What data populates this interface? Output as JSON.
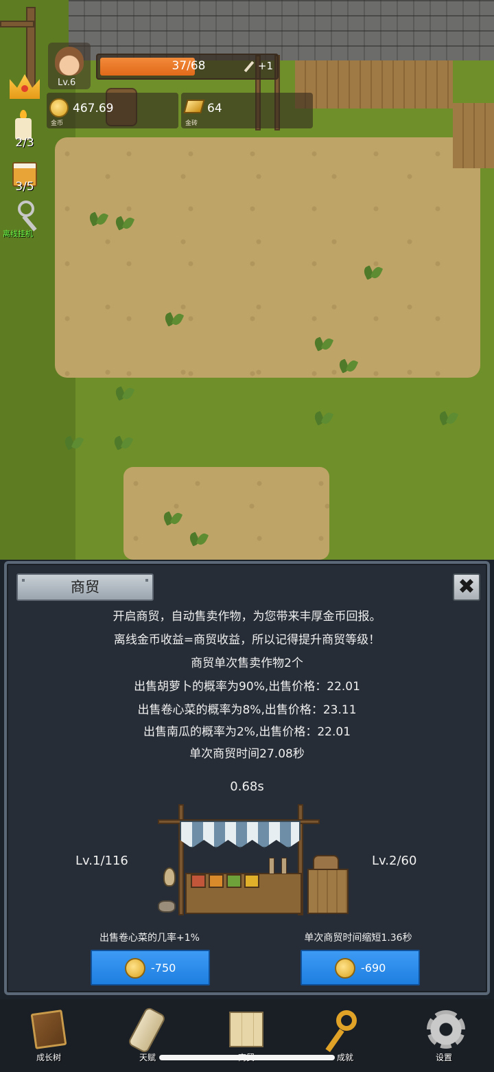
{
  "hud": {
    "level": "Lv.6",
    "xp_text": "37/68",
    "xp_progress": 0.544,
    "xp_bonus": "+1",
    "coins": "467.69",
    "coins_label": "金币",
    "gold_bars": "64",
    "gold_label": "金砖"
  },
  "side": {
    "candle_count": "2/3",
    "drink_count": "3/5",
    "offline_label": "离线挂机"
  },
  "panel": {
    "title": "商贸",
    "close_icon": "✖",
    "lines": [
      "开启商贸，自动售卖作物，为您带来丰厚金币回报。",
      "离线金币收益=商贸收益，所以记得提升商贸等级！",
      "商贸单次售卖作物2个",
      "出售胡萝卜的概率为90%,出售价格：22.01",
      "出售卷心菜的概率为8%,出售价格：23.11",
      "出售南瓜的概率为2%,出售价格：22.01",
      "单次商贸时间27.08秒"
    ],
    "timer": "0.68s",
    "left_level": "Lv.1/116",
    "right_level": "Lv.2/60",
    "left_upgrade_label": "出售卷心菜的几率+1%",
    "right_upgrade_label": "单次商贸时间缩短1.36秒",
    "left_cost": "-750",
    "right_cost": "-690"
  },
  "nav": {
    "items": [
      {
        "label": "成长树",
        "icon": "book-icon"
      },
      {
        "label": "天赋",
        "icon": "scroll-icon"
      },
      {
        "label": "商贸",
        "icon": "map-icon"
      },
      {
        "label": "成就",
        "icon": "key-icon"
      },
      {
        "label": "设置",
        "icon": "gear-icon"
      }
    ]
  }
}
